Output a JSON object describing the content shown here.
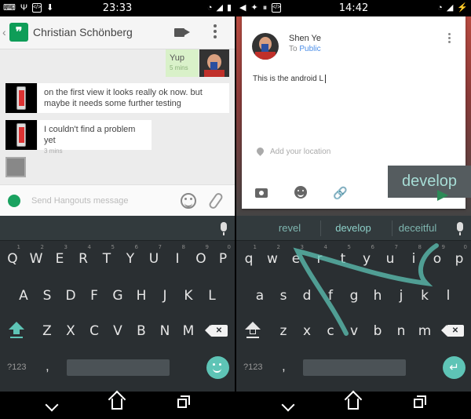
{
  "left": {
    "status": {
      "time": "23:33"
    },
    "appbar": {
      "contact": "Christian Schönberg"
    },
    "messages": [
      {
        "text": "Yup",
        "time": "5 mins"
      },
      {
        "text": "on the first view it looks really ok now. but maybe it needs some further testing"
      },
      {
        "text": "I couldn't find a problem yet",
        "time": "3 mins"
      }
    ],
    "composer": {
      "placeholder": "Send Hangouts message"
    },
    "keyboard": {
      "row1": [
        "Q",
        "W",
        "E",
        "R",
        "T",
        "Y",
        "U",
        "I",
        "O",
        "P"
      ],
      "nums": [
        "1",
        "2",
        "3",
        "4",
        "5",
        "6",
        "7",
        "8",
        "9",
        "0"
      ],
      "row2": [
        "A",
        "S",
        "D",
        "F",
        "G",
        "H",
        "J",
        "K",
        "L"
      ],
      "row3": [
        "Z",
        "X",
        "C",
        "V",
        "B",
        "N",
        "M"
      ],
      "sym": "?123",
      "comma": ","
    }
  },
  "right": {
    "status": {
      "time": "14:42"
    },
    "post": {
      "name": "Shen Ye",
      "to_label": "To",
      "audience": "Public",
      "text": "This is the android L",
      "location_placeholder": "Add your location"
    },
    "link_glyph": "🔗",
    "preview_word": "develop",
    "suggestions": [
      "revel",
      "develop",
      "deceitful"
    ],
    "keyboard": {
      "row1": [
        "q",
        "w",
        "e",
        "r",
        "t",
        "y",
        "u",
        "i",
        "o",
        "p"
      ],
      "nums": [
        "1",
        "2",
        "3",
        "4",
        "5",
        "6",
        "7",
        "8",
        "9",
        "0"
      ],
      "row2": [
        "a",
        "s",
        "d",
        "f",
        "g",
        "h",
        "j",
        "k",
        "l"
      ],
      "row3": [
        "z",
        "x",
        "c",
        "v",
        "b",
        "n",
        "m"
      ],
      "sym": "?123",
      "comma": ",",
      "enter": "↵"
    }
  },
  "colors": {
    "accent": "#5ec4b6",
    "hangouts": "#0f9d58",
    "link": "#4b8ee8"
  }
}
